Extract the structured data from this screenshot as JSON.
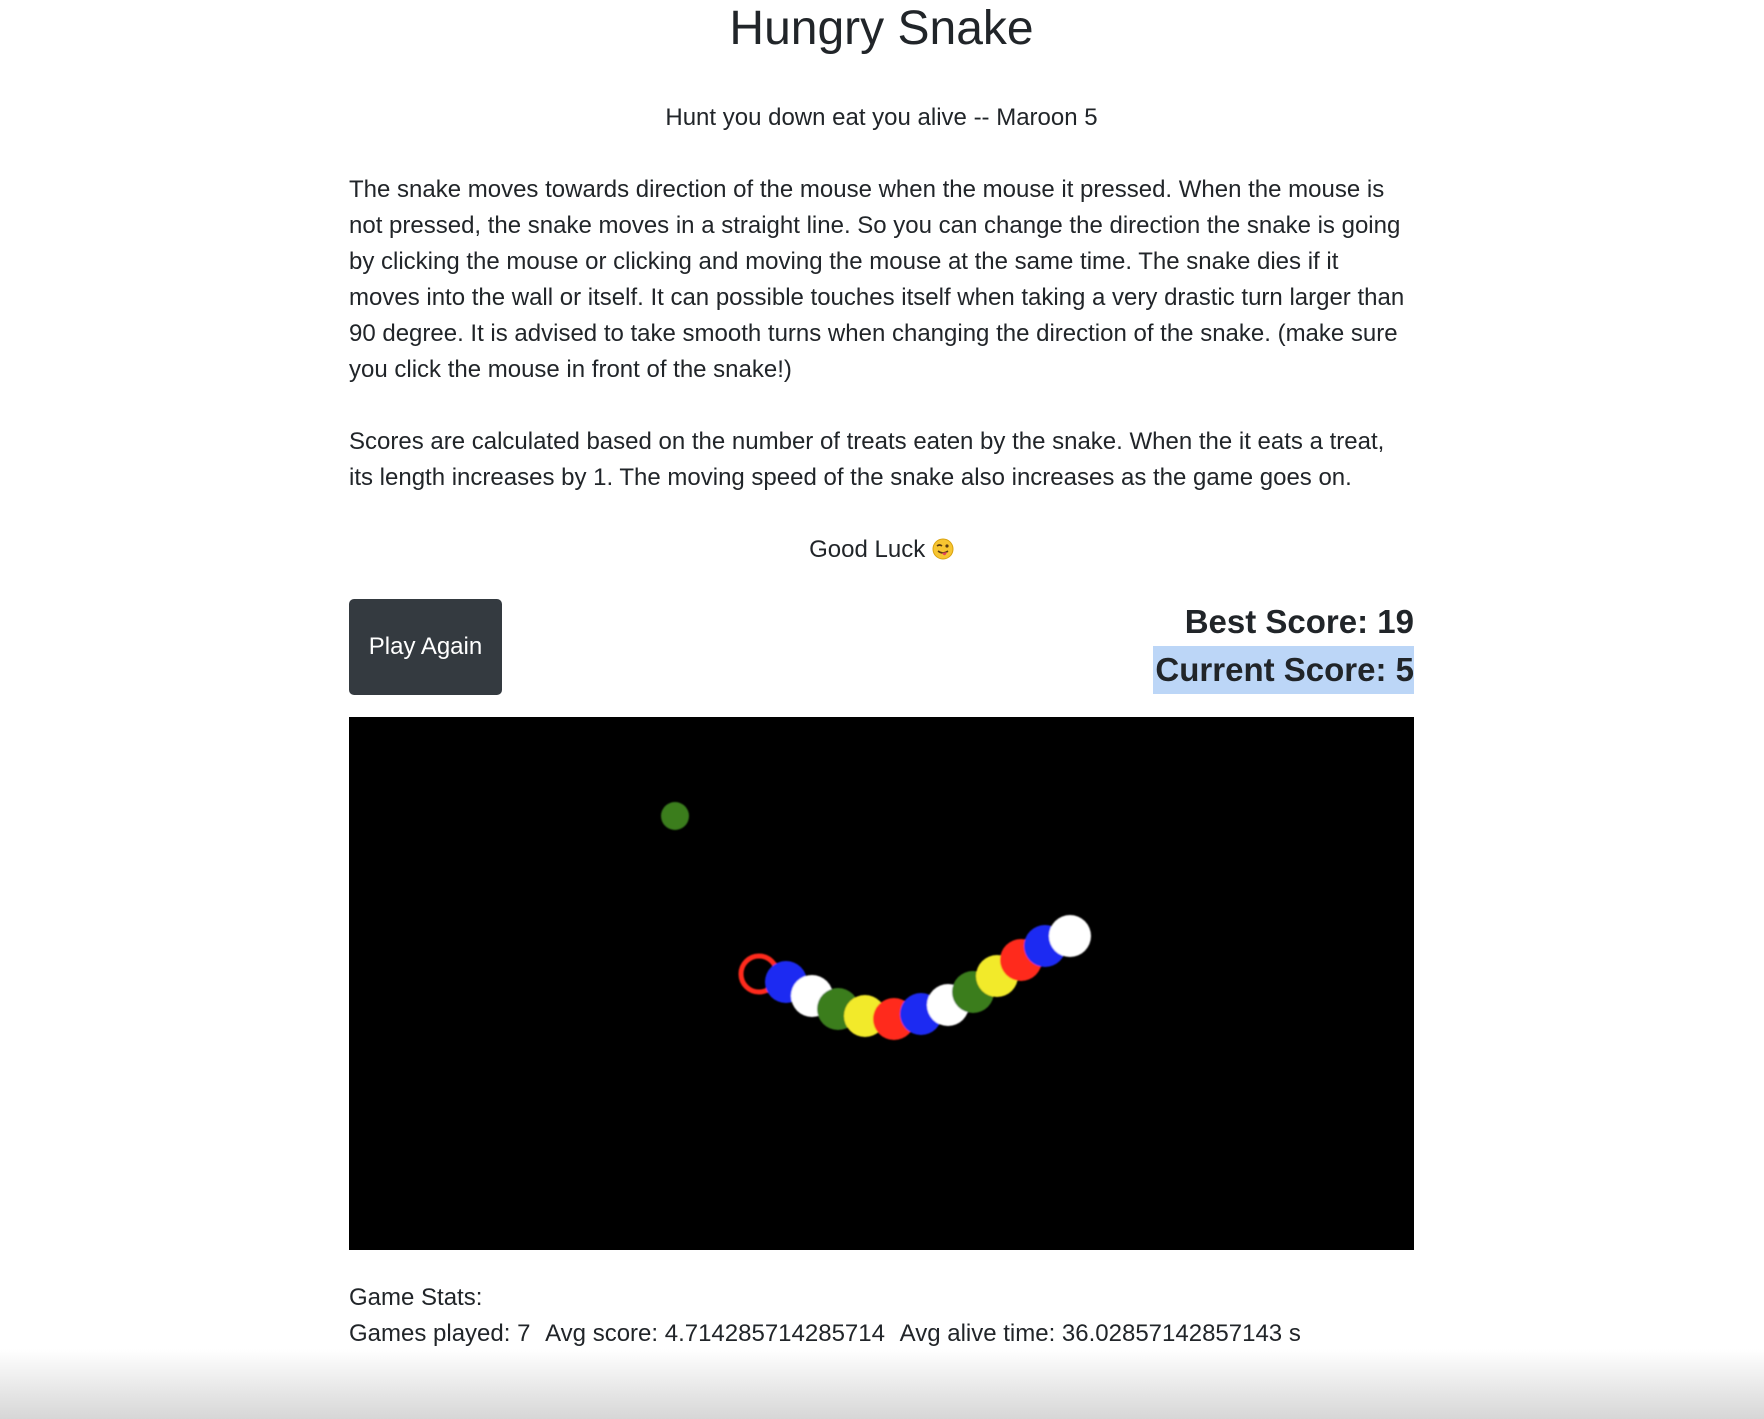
{
  "header": {
    "title": "Hungry Snake",
    "quote": "Hunt you down eat you alive -- Maroon 5"
  },
  "instructions": {
    "paragraph1": "The snake moves towards direction of the mouse when the mouse it pressed. When the mouse is not pressed, the snake moves in a straight line. So you can change the direction the snake is going by clicking the mouse or clicking and moving the mouse at the same time. The snake dies if it moves into the wall or itself. It can possible touches itself when taking a very drastic turn larger than 90 degree. It is advised to take smooth turns when changing the direction of the snake. (make sure you click the mouse in front of the snake!)",
    "paragraph2": "Scores are calculated based on the number of treats eaten by the snake. When the it eats a treat, its length increases by 1. The moving speed of the snake also increases as the game goes on.",
    "good_luck": "Good Luck",
    "good_luck_icon": "winking-face-with-tongue-icon"
  },
  "controls": {
    "play_again_label": "Play Again"
  },
  "scores": {
    "best_label": "Best Score: 19",
    "current_label": "Current Score: 5"
  },
  "game": {
    "background": "#000000",
    "treat_color": "#3a7d1e",
    "snake_colors": [
      "#ff2a1a",
      "#1f2cf2",
      "#ffffff",
      "#3a7d1e",
      "#f2ea2a"
    ]
  },
  "stats": {
    "heading": "Game Stats:",
    "games_played": "Games played: 7",
    "avg_score": "Avg score: 4.714285714285714",
    "avg_alive_time": "Avg alive time: 36.02857142857143 s"
  }
}
